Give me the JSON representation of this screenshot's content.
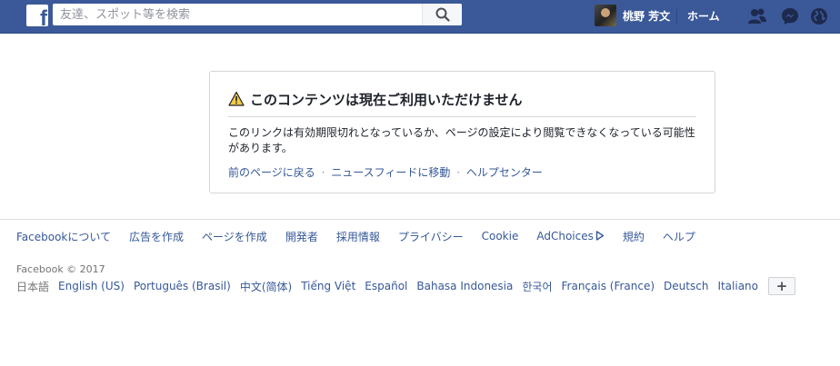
{
  "header": {
    "logo_letter": "f",
    "search_placeholder": "友達、スポット等を検索",
    "user_name": "桃野 芳文",
    "home_label": "ホーム",
    "icons": [
      "friend-requests-icon",
      "messenger-icon",
      "notifications-globe-icon"
    ],
    "colors": {
      "bar": "#3b5998",
      "bar_border": "#29487d"
    }
  },
  "notice": {
    "title": "このコンテンツは現在ご利用いただけません",
    "message": "このリンクは有効期限切れとなっているか、ページの設定により閲覧できなくなっている可能性があります。",
    "links": {
      "back": "前のページに戻る",
      "sep1": "·",
      "news_feed": "ニュースフィードに移動",
      "sep2": "·",
      "help": "ヘルプセンター"
    },
    "icon": "warning-triangle-icon"
  },
  "footer": {
    "links": [
      "Facebookについて",
      "広告を作成",
      "ページを作成",
      "開発者",
      "採用情報",
      "プライバシー",
      "Cookie",
      "AdChoices",
      "規約",
      "ヘルプ"
    ],
    "copyright": "Facebook © 2017",
    "current_language": "日本語",
    "languages": [
      "English (US)",
      "Português (Brasil)",
      "中文(简体)",
      "Tiếng Việt",
      "Español",
      "Bahasa Indonesia",
      "한국어",
      "Français (France)",
      "Deutsch",
      "Italiano"
    ],
    "more_label": "+"
  }
}
